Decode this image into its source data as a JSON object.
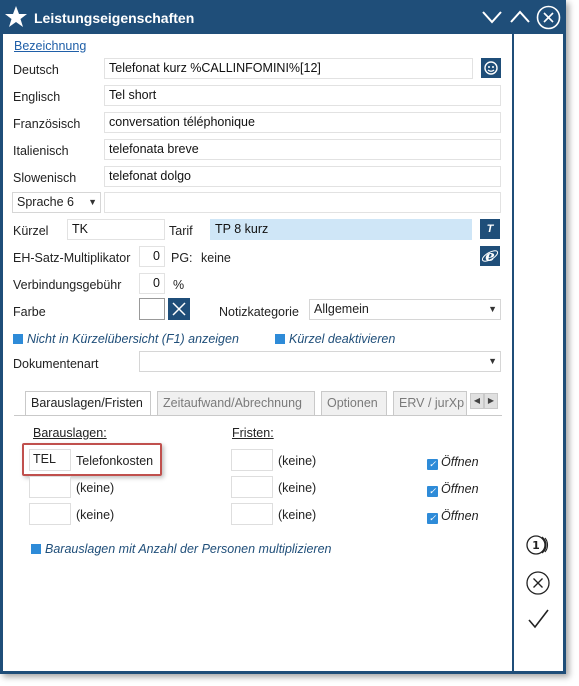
{
  "window": {
    "title": "Leistungseigenschaften"
  },
  "form": {
    "bezeichnung_label": "Bezeichnung",
    "rows": [
      {
        "label": "Deutsch",
        "value": "Telefonat kurz %CALLINFOMINI%[12]"
      },
      {
        "label": "Englisch",
        "value": "Tel short"
      },
      {
        "label": "Französisch",
        "value": "conversation téléphonique"
      },
      {
        "label": "Italienisch",
        "value": "telefonata breve"
      },
      {
        "label": "Slowenisch",
        "value": "telefonat dolgo"
      }
    ],
    "sprache_select": "Sprache 6",
    "sprache_value": "",
    "kuerzel_label": "Kürzel",
    "kuerzel_value": "TK",
    "tarif_label": "Tarif",
    "tarif_value": "TP 8 kurz",
    "tarif_btn": "T",
    "eh_label": "EH-Satz-Multiplikator",
    "eh_value": "0",
    "pg_label": "PG:",
    "pg_value": "keine",
    "verbindung_label": "Verbindungsgebühr",
    "verbindung_value": "0",
    "verbindung_unit": "%",
    "farbe_label": "Farbe",
    "notiz_label": "Notizkategorie",
    "notiz_value": "Allgemein",
    "nicht_kuerzel": "Nicht in Kürzelübersicht (F1) anzeigen",
    "kuerzel_deakt": "Kürzel deaktivieren",
    "dokumentenart_label": "Dokumentenart",
    "dokumentenart_value": ""
  },
  "tabs": [
    {
      "label": "Barauslagen/Fristen"
    },
    {
      "label": "Zeitaufwand/Abrechnung"
    },
    {
      "label": "Optionen"
    },
    {
      "label": "ERV / jurXp"
    }
  ],
  "panel": {
    "barauslagen_label": "Barauslagen:",
    "fristen_label": "Fristen:",
    "barauslagen": [
      {
        "code": "TEL",
        "text": "Telefonkosten"
      },
      {
        "code": "",
        "text": "(keine)"
      },
      {
        "code": "",
        "text": "(keine)"
      }
    ],
    "fristen": [
      {
        "code": "",
        "text": "(keine)",
        "check": "Öffnen"
      },
      {
        "code": "",
        "text": "(keine)",
        "check": "Öffnen"
      },
      {
        "code": "",
        "text": "(keine)",
        "check": "Öffnen"
      }
    ],
    "multiplizieren": "Barauslagen mit Anzahl der Personen multiplizieren"
  },
  "colors": {
    "titlebar": "#1f4e79",
    "accent_checkbox": "#2e8bd8",
    "highlight_border": "#c0504d",
    "tarif_field": "#cfe6f7"
  },
  "icons": {
    "app": "star-icon",
    "minimize": "chevron-down-icon",
    "maximize": "chevron-up-icon",
    "close": "close-icon",
    "side_one": "one-step-icon",
    "side_cancel": "cancel-icon",
    "side_ok": "checkmark-icon"
  }
}
